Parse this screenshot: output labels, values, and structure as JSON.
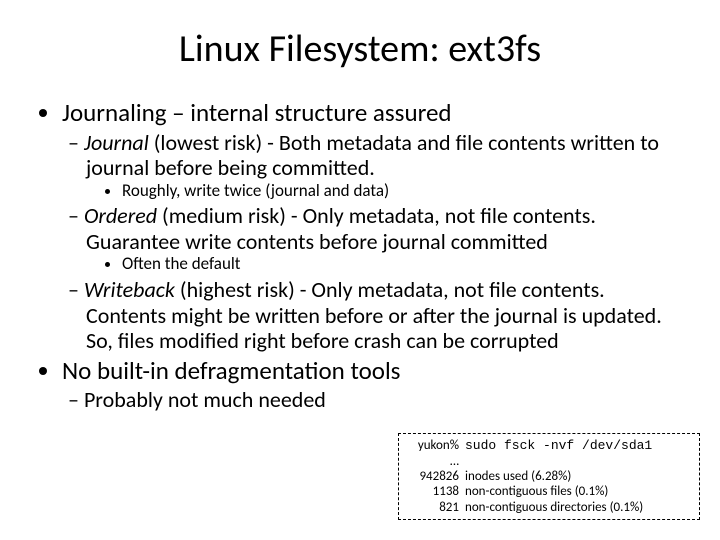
{
  "title": "Linux Filesystem: ext3fs",
  "b1": {
    "head": "Journaling – internal structure assured",
    "journal_term": "Journal",
    "journal_rest": " (lowest risk) - Both metadata and file contents written to journal before being committed.",
    "journal_sub": "Roughly, write twice (journal and data)",
    "ordered_term": "Ordered",
    "ordered_rest": " (medium risk) - Only metadata, not file contents. Guarantee write contents before journal committed",
    "ordered_sub": "Often the default",
    "writeback_term": "Writeback",
    "writeback_rest": " (highest risk) - Only metadata, not file contents. Contents might be written before or after the journal is updated. So, files modified right before crash can be corrupted"
  },
  "b2": {
    "head": "No built-in defragmentation tools",
    "sub": "Probably not much needed"
  },
  "code": {
    "l1_prompt": "yukon%",
    "l1_cmd": "sudo fsck -nvf /dev/sda1",
    "l2": "…",
    "r1_n": "942826",
    "r1_t": "inodes used (6.28%)",
    "r2_n": "1138",
    "r2_t": "non-contiguous files (0.1%)",
    "r3_n": "821",
    "r3_t": "non-contiguous directories (0.1%)"
  }
}
